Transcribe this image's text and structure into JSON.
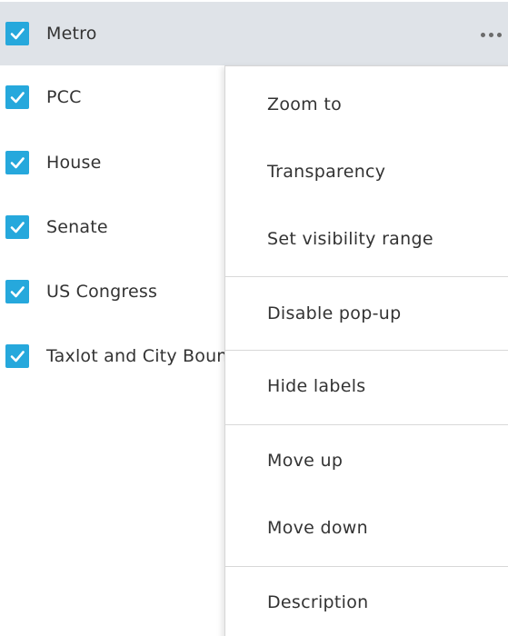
{
  "layers": [
    {
      "label": "Metro",
      "checked": true,
      "selected": true
    },
    {
      "label": "PCC",
      "checked": true
    },
    {
      "label": "House",
      "checked": true
    },
    {
      "label": "Senate",
      "checked": true
    },
    {
      "label": "US Congress",
      "checked": true
    },
    {
      "label": "Taxlot and City Boun",
      "checked": true
    }
  ],
  "menu": {
    "items": [
      {
        "label": "Zoom to"
      },
      {
        "label": "Transparency"
      },
      {
        "label": "Set visibility range"
      },
      {
        "label": "Disable pop-up"
      },
      {
        "label": "Hide labels"
      },
      {
        "label": "Move up"
      },
      {
        "label": "Move down"
      },
      {
        "label": "Description"
      }
    ]
  },
  "icons": {
    "checkbox": "checkmark-icon",
    "more": "more-options-icon"
  },
  "colors": {
    "checkbox": "#26a8dc",
    "selected_row": "#dfe3e8",
    "text": "#333333"
  }
}
